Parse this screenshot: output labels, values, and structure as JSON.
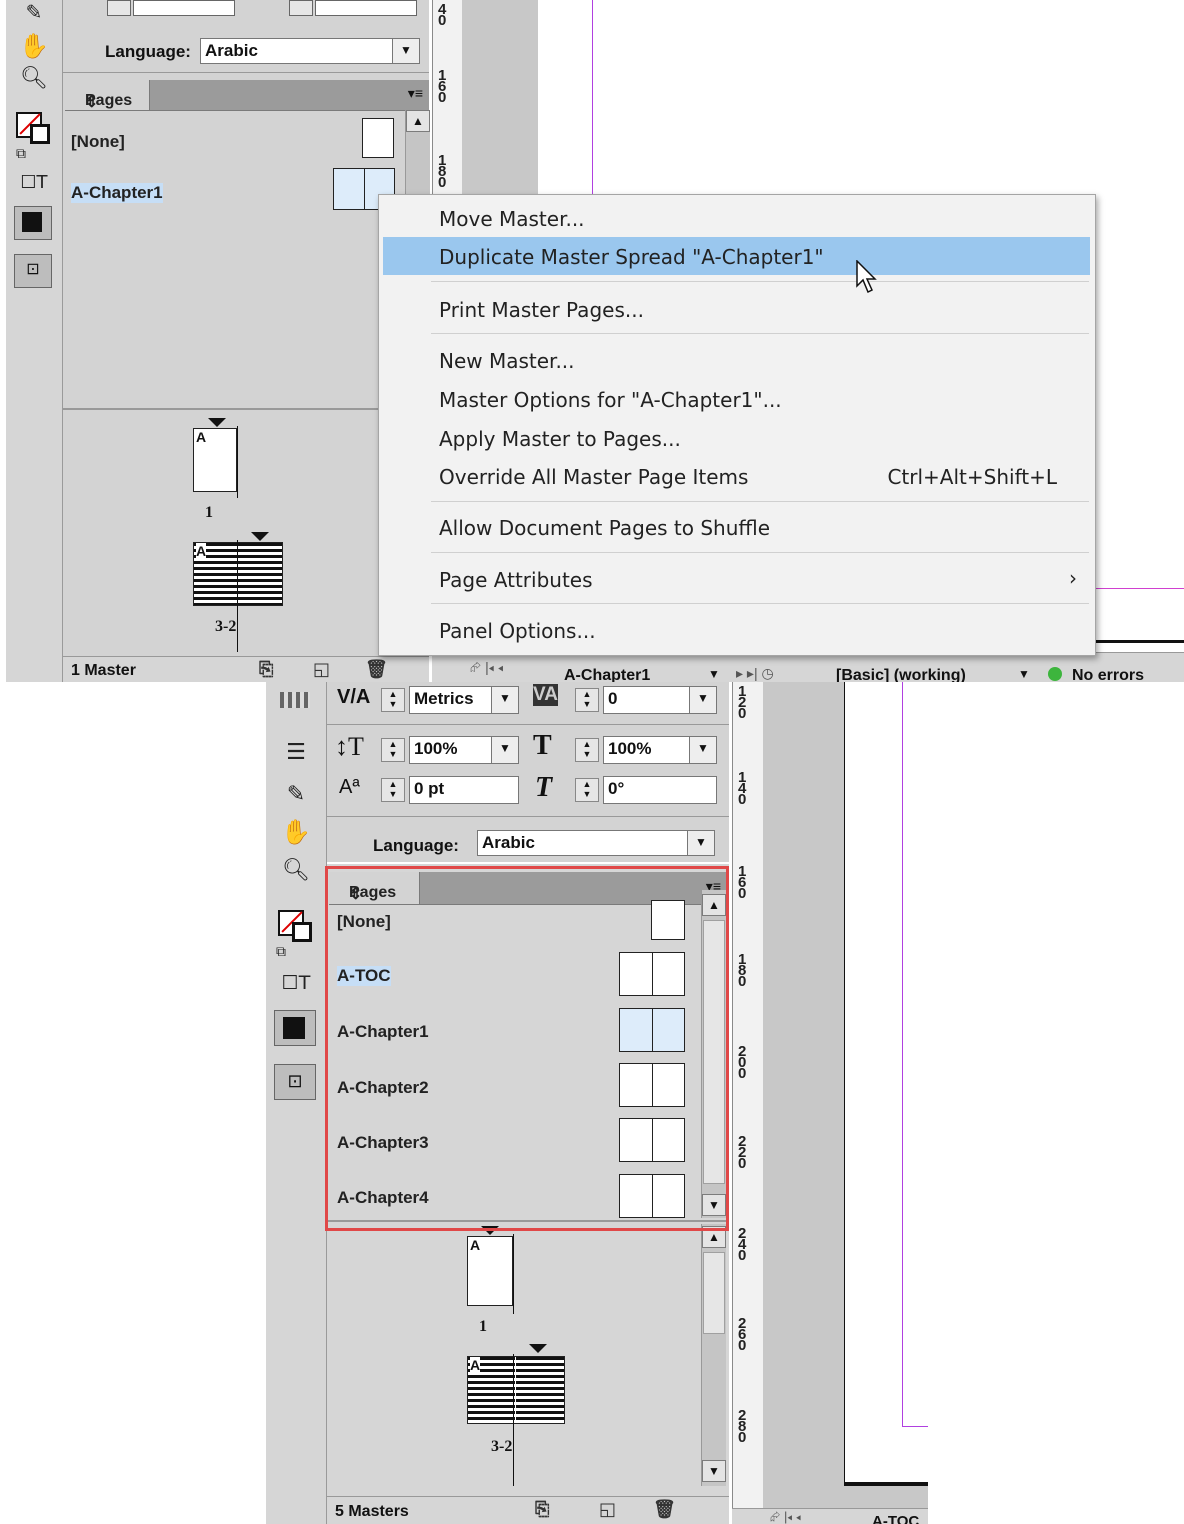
{
  "top": {
    "language_label": "Language:",
    "language_value": "Arabic",
    "pages_tab": "Pages",
    "masters": [
      {
        "label": "[None]"
      },
      {
        "label": "A-Chapter1",
        "selected": true
      }
    ],
    "doc_pages": [
      {
        "label": "1",
        "master_letter": "A"
      },
      {
        "label": "3-2",
        "master_letter": "A"
      }
    ],
    "status": "1 Master",
    "ruler_numbers": [
      "160",
      "180"
    ],
    "bottom_bar": {
      "page_field": "A-Chapter1",
      "style": "[Basic] (working)",
      "errors": "No errors"
    }
  },
  "menu": {
    "items": [
      {
        "label": "Move Master...",
        "highlighted": false
      },
      {
        "label": "Duplicate Master Spread \"A-Chapter1\"",
        "highlighted": true
      },
      {
        "label": "Print Master Pages...",
        "highlighted": false
      },
      {
        "label": "New Master...",
        "highlighted": false
      },
      {
        "label": "Master Options for \"A-Chapter1\"...",
        "highlighted": false
      },
      {
        "label": "Apply Master to Pages...",
        "highlighted": false
      },
      {
        "label": "Override All Master Page Items",
        "shortcut": "Ctrl+Alt+Shift+L",
        "highlighted": false
      },
      {
        "label": "Allow Document Pages to Shuffle",
        "highlighted": false
      },
      {
        "label": "Page Attributes",
        "submenu": true,
        "highlighted": false
      },
      {
        "label": "Panel Options...",
        "highlighted": false
      }
    ],
    "submenu_arrow": "›"
  },
  "bottom": {
    "kerning_value": "Metrics",
    "tracking_value": "0",
    "vscale_value": "100%",
    "hscale_value": "100%",
    "baseline_value": "0 pt",
    "skew_value": "0°",
    "language_label": "Language:",
    "language_value": "Arabic",
    "pages_tab": "Pages",
    "masters": [
      {
        "label": "[None]"
      },
      {
        "label": "A-TOC",
        "selected_label": true
      },
      {
        "label": "A-Chapter1",
        "selected_thumb": true
      },
      {
        "label": "A-Chapter2"
      },
      {
        "label": "A-Chapter3"
      },
      {
        "label": "A-Chapter4"
      }
    ],
    "doc_pages": [
      {
        "label": "1",
        "master_letter": "A"
      },
      {
        "label": "3-2",
        "master_letter": "A"
      }
    ],
    "status": "5 Masters",
    "ruler_numbers": [
      "120",
      "140",
      "160",
      "180",
      "200",
      "220",
      "240",
      "260",
      "280"
    ],
    "bottom_bar": {
      "page_field": "A-TOC"
    },
    "highlight_color": "#e04848"
  },
  "colors": {
    "menu_highlight": "#9ac7ee",
    "selection": "#c6def6",
    "margin_guide": "#b040e0"
  }
}
